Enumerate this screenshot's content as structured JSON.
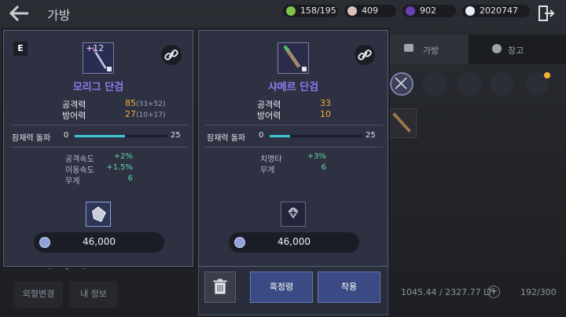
{
  "header": {
    "title": "가방"
  },
  "resources": [
    {
      "icon": "green-gem-icon",
      "value": "158/195"
    },
    {
      "icon": "pearl-icon",
      "value": "409"
    },
    {
      "icon": "purple-orb-icon",
      "value": "902"
    },
    {
      "icon": "white-crystal-icon",
      "value": "2020747"
    }
  ],
  "background": {
    "tabs": [
      "가방",
      "창고"
    ],
    "stat_weight": "1045.44 / 2327.77 LT",
    "slot_count": "192/300",
    "left_buttons": [
      "외형변경",
      "내 정보"
    ]
  },
  "left_card": {
    "grade_badge": "E",
    "enhance": "+12",
    "name": "모리그 단검",
    "stats": [
      {
        "label": "공격력",
        "value": "85",
        "detail": "(33+52)"
      },
      {
        "label": "방어력",
        "value": "27",
        "detail": "(10+17)"
      }
    ],
    "potential": {
      "label": "잠재력 돌파",
      "min": "0",
      "max": "25",
      "fill_fraction": 0.54
    },
    "sub_stats": [
      {
        "label": "공격속도",
        "value": "+2%"
      },
      {
        "label": "이동속도",
        "value": "+1.5%"
      },
      {
        "label": "무게",
        "value": "6"
      }
    ],
    "price": "46,000"
  },
  "right_card": {
    "name": "샤메르 단검",
    "stats": [
      {
        "label": "공격력",
        "value": "33"
      },
      {
        "label": "방어력",
        "value": "10"
      }
    ],
    "potential": {
      "label": "잠재력 돌파",
      "min": "0",
      "max": "25",
      "fill_fraction": 0.22
    },
    "sub_stats": [
      {
        "label": "치명타",
        "value": "+3%"
      },
      {
        "label": "무게",
        "value": "6"
      }
    ],
    "price": "46,000"
  },
  "actions": {
    "black_spirit_label": "흑정령",
    "equip_label": "착용"
  },
  "colors": {
    "item_name": "#8d7bf0",
    "stat_value": "#f2b233",
    "sub_value": "#63d6a5",
    "potential_fill": "#3fc7d7"
  }
}
